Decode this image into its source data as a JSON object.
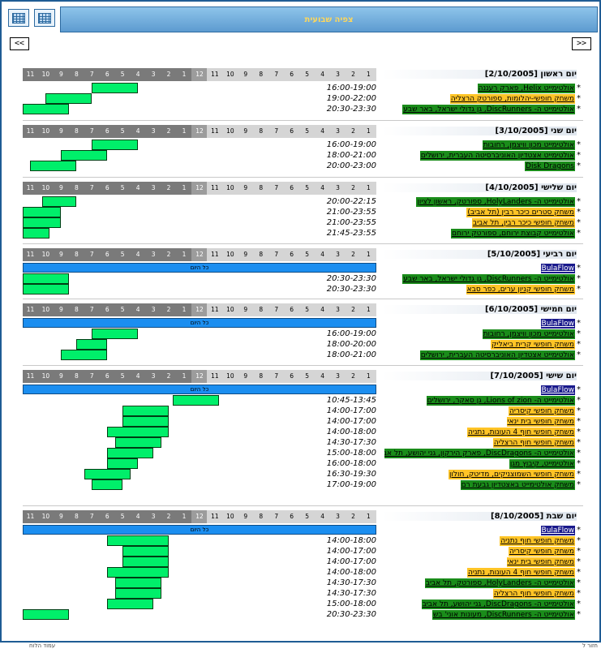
{
  "page": {
    "title": "צפיה שבועית",
    "prev_label": "<<",
    "next_label": ">>",
    "allday_label": "כל היום"
  },
  "scale_labels": [
    "11",
    "10",
    "9",
    "8",
    "7",
    "6",
    "5",
    "4",
    "3",
    "2",
    "1",
    "12",
    "11",
    "10",
    "9",
    "8",
    "7",
    "6",
    "5",
    "4",
    "3",
    "2",
    "1"
  ],
  "colors": {
    "bar": "#00ef6a",
    "allday": "#1b8ef0",
    "green": "#1a8c1a",
    "yellow": "#ffc426",
    "navy": "#1a1a8c"
  },
  "footer": {
    "left": "עמוד הלוח",
    "right": "חזור ל"
  },
  "days": [
    {
      "name": "יום ראשון",
      "date": "[2/10/2005]",
      "allday": false,
      "events": [
        {
          "time": "16:00-19:00",
          "start": 16,
          "end": 19,
          "title": "אולטימייט Helix, פארק רעננה",
          "color": "green"
        },
        {
          "time": "19:00-22:00",
          "start": 19,
          "end": 22,
          "title": "משחק חופשי-יהלומות, ספורטק הרצליה",
          "color": "yellow"
        },
        {
          "time": "20:30-23:30",
          "start": 20.5,
          "end": 23.5,
          "title": "אולטימייט ה- DiscRunners, גן גדולי ישראל, באר שבע",
          "color": "green"
        }
      ]
    },
    {
      "name": "יום שני",
      "date": "[3/10/2005]",
      "allday": false,
      "events": [
        {
          "time": "16:00-19:00",
          "start": 16,
          "end": 19,
          "title": "אולטימייט מכון וויצמן, רחובות",
          "color": "green"
        },
        {
          "time": "18:00-21:00",
          "start": 18,
          "end": 21,
          "title": "אולטימייט אצטדיון האוניברסיטה העברית, ירושלים",
          "color": "green"
        },
        {
          "time": "20:00-23:00",
          "start": 20,
          "end": 23,
          "title": "Disk Dragons",
          "color": "green"
        }
      ]
    },
    {
      "name": "יום שלישי",
      "date": "[4/10/2005]",
      "allday": false,
      "events": [
        {
          "time": "20:00-22:15",
          "start": 20,
          "end": 22.25,
          "title": "אולטימייט ה- HolyLanders, ספורטק, ראשון לציון",
          "color": "green"
        },
        {
          "time": "21:00-23:55",
          "start": 21,
          "end": 23.92,
          "title": "משחק סטרים כיכר רבין (תל אביב)",
          "color": "yellow"
        },
        {
          "time": "21:00-23:55",
          "start": 21,
          "end": 23.92,
          "title": "משחק חופשי כיכר רבין, תל אביב",
          "color": "yellow"
        },
        {
          "time": "21:45-23:55",
          "start": 21.75,
          "end": 23.92,
          "title": "אולטימייט קבוצת ירוחם, ספורטק ירוחם",
          "color": "green"
        }
      ]
    },
    {
      "name": "יום רביעי",
      "date": "[5/10/2005]",
      "allday": true,
      "allday_title": "BulaFlow",
      "events": [
        {
          "time": "20:30-23:30",
          "start": 20.5,
          "end": 23.5,
          "title": "אולטימייט ה- DiscRunners, גן גדולי ישראל, באר שבע",
          "color": "green"
        },
        {
          "time": "20:30-23:30",
          "start": 20.5,
          "end": 23.5,
          "title": "משחק חופשי קניון ערים, כפר סבא",
          "color": "yellow"
        }
      ]
    },
    {
      "name": "יום חמישי",
      "date": "[6/10/2005]",
      "allday": true,
      "allday_title": "BulaFlow",
      "events": [
        {
          "time": "16:00-19:00",
          "start": 16,
          "end": 19,
          "title": "אולטימייט מכון וויצמן, רחובות",
          "color": "green"
        },
        {
          "time": "18:00-20:00",
          "start": 18,
          "end": 20,
          "title": "משחק חופשי קרית ביאליק",
          "color": "yellow"
        },
        {
          "time": "18:00-21:00",
          "start": 18,
          "end": 21,
          "title": "אולטימייט אצטדיון האוניברסיטה העברית, ירושלים",
          "color": "green"
        }
      ]
    },
    {
      "name": "יום שישי",
      "date": "[7/10/2005]",
      "allday": true,
      "allday_title": "BulaFlow",
      "events": [
        {
          "time": "10:45-13:45",
          "start": 10.75,
          "end": 13.75,
          "title": "אולטימייט ה- Lions of zion, גן סאקר, ירושלים",
          "color": "green"
        },
        {
          "time": "14:00-17:00",
          "start": 14,
          "end": 17,
          "title": "משחק חופשי קיסריה",
          "color": "yellow"
        },
        {
          "time": "14:00-17:00",
          "start": 14,
          "end": 17,
          "title": "משחק חופשי בית ינאי",
          "color": "yellow"
        },
        {
          "time": "14:00-18:00",
          "start": 14,
          "end": 18,
          "title": "משחק חופשי חוף 4 העונות, נתניה",
          "color": "yellow"
        },
        {
          "time": "14:30-17:30",
          "start": 14.5,
          "end": 17.5,
          "title": "משחק חופשי חוף הרצליה",
          "color": "yellow"
        },
        {
          "time": "15:00-18:00",
          "start": 15,
          "end": 18,
          "title": "אולטימייט ה- DiscDragons, פארק הירקון, גני יהושע, תל אביב",
          "color": "green"
        },
        {
          "time": "16:00-18:00",
          "start": 16,
          "end": 18,
          "title": "אולטימייט, קיבוץ מגן",
          "color": "green"
        },
        {
          "time": "16:30-19:30",
          "start": 16.5,
          "end": 19.5,
          "title": "משחק חופשי השמוצניקים, מדיטק, חולון",
          "color": "yellow"
        },
        {
          "time": "17:00-19:00",
          "start": 17,
          "end": 19,
          "title": "משחק אולטימייט באצטדיון גבעת רם",
          "color": "green"
        }
      ]
    },
    {
      "name": "יום שבת",
      "date": "[8/10/2005]",
      "allday": true,
      "allday_title": "BulaFlow",
      "events": [
        {
          "time": "14:00-18:00",
          "start": 14,
          "end": 18,
          "title": "משחק חופשי חוף נתניה",
          "color": "yellow"
        },
        {
          "time": "14:00-17:00",
          "start": 14,
          "end": 17,
          "title": "משחק חופשי קיסריה",
          "color": "yellow"
        },
        {
          "time": "14:00-17:00",
          "start": 14,
          "end": 17,
          "title": "משחק חופשי בית ינאי",
          "color": "yellow"
        },
        {
          "time": "14:00-18:00",
          "start": 14,
          "end": 18,
          "title": "משחק חופשי חוף 4 העונות, נתניה",
          "color": "yellow"
        },
        {
          "time": "14:30-17:30",
          "start": 14.5,
          "end": 17.5,
          "title": "אולטימייט ה- HolyLanders, ספורטק, תל אביב",
          "color": "green"
        },
        {
          "time": "14:30-17:30",
          "start": 14.5,
          "end": 17.5,
          "title": "משחק חופשי חוף הרצליה",
          "color": "yellow"
        },
        {
          "time": "15:00-18:00",
          "start": 15,
          "end": 18,
          "title": "אולטימייט ה- DiscDragons, גני יהושע, תל אביב",
          "color": "green"
        },
        {
          "time": "20:30-23:30",
          "start": 20.5,
          "end": 23.5,
          "title": "אולטימייט ה- DiscRunners, מעונות אוני' בש",
          "color": "green"
        }
      ]
    }
  ]
}
